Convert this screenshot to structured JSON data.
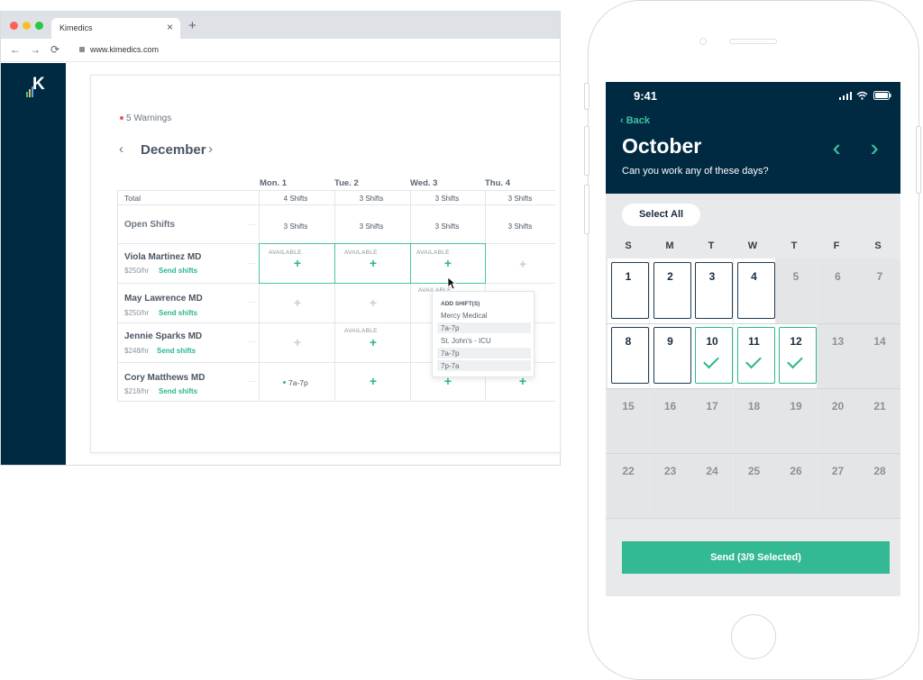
{
  "browser": {
    "tab_title": "Kimedics",
    "tab_close": "×",
    "new_tab": "+",
    "url": "www.kimedics.com",
    "nav": {
      "back": "←",
      "forward": "→",
      "reload": "⟳"
    }
  },
  "app": {
    "logo_letter": "K",
    "warnings": "5 Warnings",
    "month": "December",
    "prev": "‹",
    "next": "›",
    "days": [
      "Mon. 1",
      "Tue. 2",
      "Wed. 3",
      "Thu. 4"
    ],
    "total_label": "Total",
    "totals": [
      "4 Shifts",
      "3 Shifts",
      "3 Shifts",
      "3 Shifts"
    ],
    "open_shifts_label": "Open Shifts",
    "open_shifts": [
      "3 Shifts",
      "3 Shifts",
      "3 Shifts",
      "3 Shifts"
    ],
    "dash": "···",
    "available_label": "AVAILABLE",
    "plus": "+",
    "send_shifts": "Send shifts",
    "providers": [
      {
        "name": "Viola Martinez MD",
        "rate": "$250/hr"
      },
      {
        "name": "May Lawrence MD",
        "rate": "$250/hr"
      },
      {
        "name": "Jennie Sparks MD",
        "rate": "$248/hr"
      },
      {
        "name": "Cory Matthews MD",
        "rate": "$218/hr"
      }
    ],
    "shift_chip": "7a-7p",
    "popup": {
      "title": "ADD SHIFT(S)",
      "items": [
        "Mercy Medical",
        "7a-7p",
        "St. John's - ICU",
        "7a-7p",
        "7p-7a"
      ]
    }
  },
  "phone": {
    "time": "9:41",
    "back": "Back",
    "title": "October",
    "question": "Can you work any of these days?",
    "select_all": "Select All",
    "weekdays": [
      "S",
      "M",
      "T",
      "W",
      "T",
      "F",
      "S"
    ],
    "weeks": [
      [
        {
          "day": "1",
          "state": "available"
        },
        {
          "day": "2",
          "state": "available"
        },
        {
          "day": "3",
          "state": "available"
        },
        {
          "day": "4",
          "state": "available"
        },
        {
          "day": "5",
          "state": "off"
        },
        {
          "day": "6",
          "state": "off"
        },
        {
          "day": "7",
          "state": "off"
        }
      ],
      [
        {
          "day": "8",
          "state": "available"
        },
        {
          "day": "9",
          "state": "available"
        },
        {
          "day": "10",
          "state": "selected"
        },
        {
          "day": "11",
          "state": "selected"
        },
        {
          "day": "12",
          "state": "selected"
        },
        {
          "day": "13",
          "state": "off"
        },
        {
          "day": "14",
          "state": "off"
        }
      ],
      [
        {
          "day": "15",
          "state": "off"
        },
        {
          "day": "16",
          "state": "off"
        },
        {
          "day": "17",
          "state": "off"
        },
        {
          "day": "18",
          "state": "off"
        },
        {
          "day": "19",
          "state": "off"
        },
        {
          "day": "20",
          "state": "off"
        },
        {
          "day": "21",
          "state": "off"
        }
      ],
      [
        {
          "day": "22",
          "state": "off"
        },
        {
          "day": "23",
          "state": "off"
        },
        {
          "day": "24",
          "state": "off"
        },
        {
          "day": "25",
          "state": "off"
        },
        {
          "day": "26",
          "state": "off"
        },
        {
          "day": "27",
          "state": "off"
        },
        {
          "day": "28",
          "state": "off"
        }
      ]
    ],
    "send_button": "Send (3/9 Selected)"
  },
  "colors": {
    "navy": "#002a42",
    "accent": "#2db690"
  }
}
